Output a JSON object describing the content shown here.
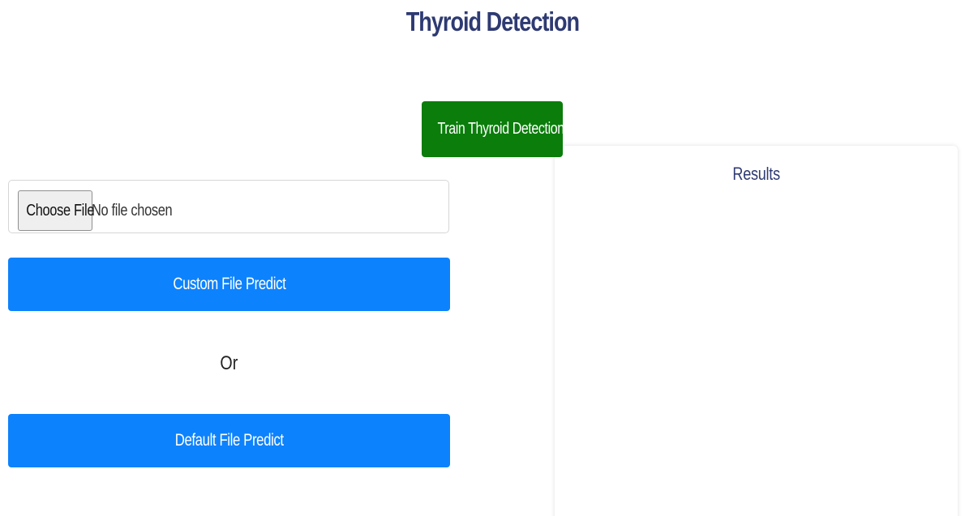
{
  "header": {
    "title": "Thyroid Detection"
  },
  "actions": {
    "train_label": "Train Thyroid Detection",
    "custom_predict_label": "Custom File Predict",
    "default_predict_label": "Default File Predict",
    "or_label": "Or"
  },
  "file_input": {
    "button_label": "Choose File",
    "status": "No file chosen"
  },
  "results": {
    "title": "Results"
  },
  "colors": {
    "title": "#2e3a72",
    "train_button": "#0a7d0a",
    "predict_button": "#0d82fd"
  }
}
